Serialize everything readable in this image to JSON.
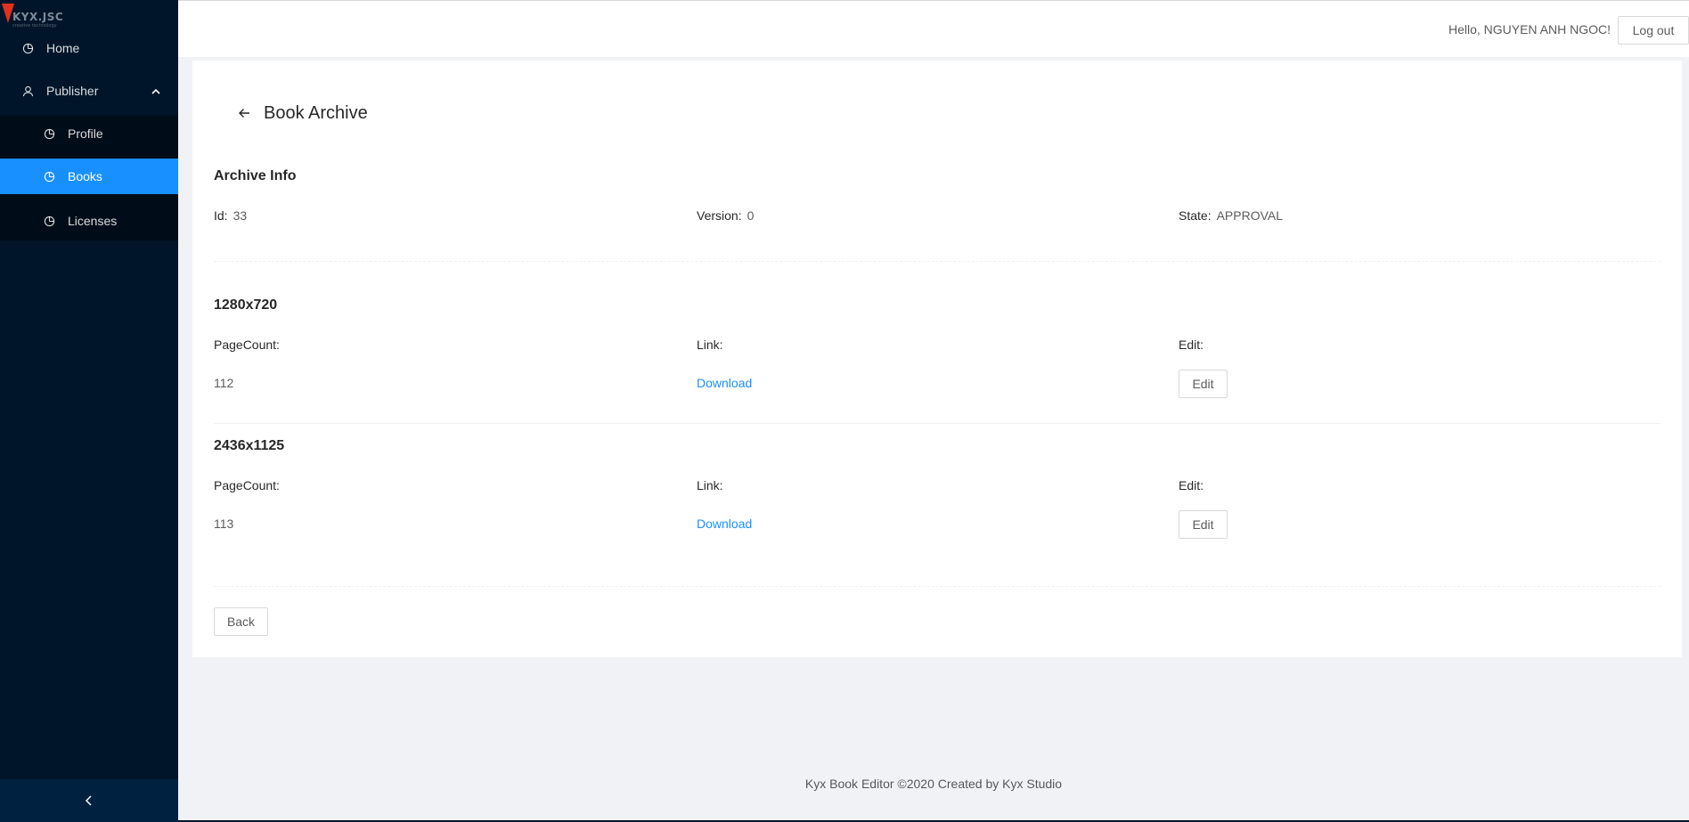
{
  "brand": {
    "name": "KYX.JSC",
    "tagline": "creative technology"
  },
  "sidebar": {
    "items": [
      {
        "label": "Home",
        "icon": "pie-chart-icon"
      },
      {
        "label": "Publisher",
        "icon": "user-icon",
        "expanded": true
      },
      {
        "label": "Profile",
        "icon": "pie-chart-icon"
      },
      {
        "label": "Books",
        "icon": "pie-chart-icon",
        "active": true
      },
      {
        "label": "Licenses",
        "icon": "pie-chart-icon"
      }
    ],
    "collapse_icon": "chevron-left-icon"
  },
  "header": {
    "greeting": "Hello, NGUYEN ANH NGOC!",
    "logout_label": "Log out"
  },
  "page": {
    "title": "Book Archive",
    "archive_info": {
      "title": "Archive Info",
      "id_label": "Id:",
      "id_value": "33",
      "version_label": "Version:",
      "version_value": "0",
      "state_label": "State:",
      "state_value": "APPROVAL"
    },
    "formats": [
      {
        "title": "1280x720",
        "pagecount_label": "PageCount:",
        "link_label": "Link:",
        "edit_label": "Edit:",
        "pagecount": "112",
        "link_text": "Download",
        "edit_button": "Edit"
      },
      {
        "title": "2436x1125",
        "pagecount_label": "PageCount:",
        "link_label": "Link:",
        "edit_label": "Edit:",
        "pagecount": "113",
        "link_text": "Download",
        "edit_button": "Edit"
      }
    ],
    "back_button": "Back"
  },
  "footer": {
    "text": "Kyx Book Editor ©2020 Created by Kyx Studio"
  },
  "colors": {
    "sider_bg": "#001529",
    "active": "#1890ff",
    "link": "#1890ff"
  }
}
